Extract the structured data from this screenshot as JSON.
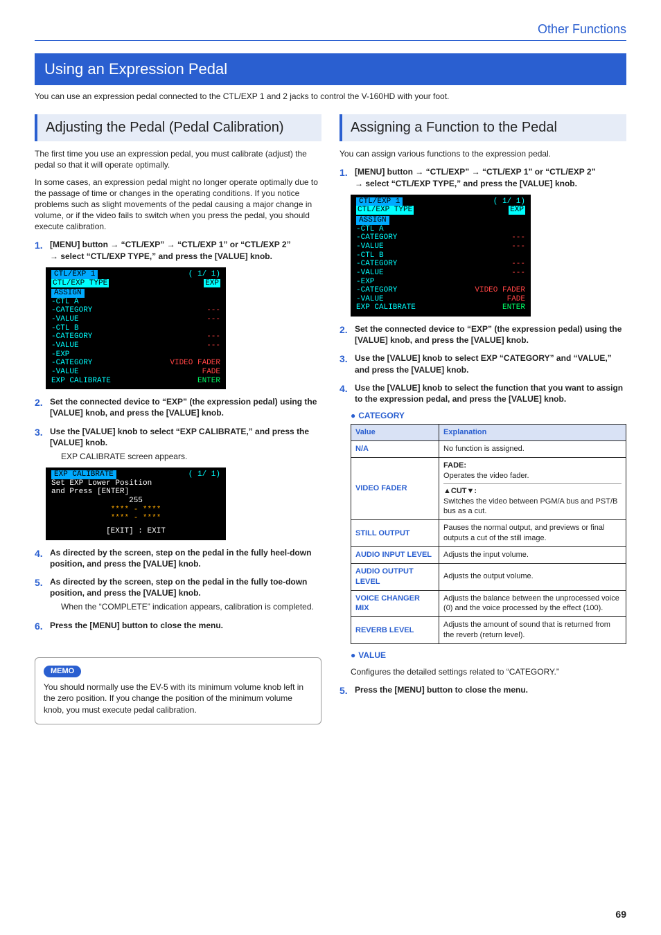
{
  "header": {
    "section": "Other Functions",
    "page_number": "69"
  },
  "h2": "Using an Expression Pedal",
  "intro": "You can use an expression pedal connected to the CTL/EXP 1 and 2 jacks to control the V-160HD with your foot.",
  "left": {
    "h3": "Adjusting the Pedal (Pedal Calibration)",
    "p1": "The first time you use an expression pedal, you must calibrate (adjust) the pedal so that it will operate optimally.",
    "p2": "In some cases, an expression pedal might no longer operate optimally due to the passage of time or changes in the operating conditions. If you notice problems such as slight movements of the pedal causing a major change in volume, or if the video fails to switch when you press the pedal, you should execute calibration.",
    "step1a": "[MENU] button → “CTL/EXP” → “CTL/EXP 1” or “CTL/EXP 2”",
    "step1b": "→ select “CTL/EXP TYPE,” and press the [VALUE] knob.",
    "screenshot1": {
      "title": "CTL/EXP 1",
      "page": "( 1/ 1)",
      "type_row": {
        "label": "CTL/EXP TYPE",
        "val": "EXP"
      },
      "assign": "ASSIGN",
      "rows": [
        {
          "l": " -CTL A",
          "v": ""
        },
        {
          "l": "  -CATEGORY",
          "v": "---"
        },
        {
          "l": "  -VALUE",
          "v": "---"
        },
        {
          "l": " -CTL B",
          "v": ""
        },
        {
          "l": "  -CATEGORY",
          "v": "---"
        },
        {
          "l": "  -VALUE",
          "v": "---"
        },
        {
          "l": " -EXP",
          "v": ""
        },
        {
          "l": "  -CATEGORY",
          "v": "VIDEO FADER",
          "red": true
        },
        {
          "l": "  -VALUE",
          "v": "FADE",
          "red": true
        },
        {
          "l": " EXP CALIBRATE",
          "v": "ENTER",
          "grn": true
        }
      ]
    },
    "step2": "Set the connected device to “EXP” (the expression pedal) using the [VALUE] knob, and press the [VALUE] knob.",
    "step3": "Use the [VALUE] knob to select “EXP CALIBRATE,” and press the [VALUE] knob.",
    "step3_after": "EXP CALIBRATE screen appears.",
    "screenshot2": {
      "title": "EXP CALIBRATE",
      "page": "( 1/ 1)",
      "line1": "Set EXP Lower Position",
      "line2": "and Press [ENTER]",
      "line3": "255",
      "bars1": "**** - ****",
      "bars2": "**** - ****",
      "exit": "[EXIT] : EXIT"
    },
    "step4": "As directed by the screen, step on the pedal in the fully heel-down position, and press the [VALUE] knob.",
    "step5": "As directed by the screen, step on the pedal in the fully toe-down position, and press the [VALUE] knob.",
    "step5_after": "When the “COMPLETE” indication appears, calibration is completed.",
    "step6": "Press the [MENU] button to close the menu.",
    "memo_tag": "MEMO",
    "memo": "You should normally use the EV-5 with its minimum volume knob left in the zero position. If you change the position of the minimum volume knob, you must execute pedal calibration."
  },
  "right": {
    "h3": "Assigning a Function to the Pedal",
    "p1": "You can assign various functions to the expression pedal.",
    "step1a": "[MENU] button → “CTL/EXP” → “CTL/EXP 1” or “CTL/EXP 2”",
    "step1b": "→ select “CTL/EXP TYPE,” and press the [VALUE] knob.",
    "step2": "Set the connected device to “EXP” (the expression pedal) using the [VALUE] knob, and press the [VALUE] knob.",
    "step3": "Use the [VALUE] knob to select EXP “CATEGORY” and “VALUE,” and press the [VALUE] knob.",
    "step4": "Use the [VALUE] knob to select the function that you want to assign to the expression pedal, and press the [VALUE] knob.",
    "cat_heading": "CATEGORY",
    "table": {
      "headers": {
        "value": "Value",
        "explanation": "Explanation"
      },
      "rows": [
        {
          "v": "N/A",
          "e": "No function is assigned."
        },
        {
          "v": "VIDEO FADER",
          "e1": "FADE:",
          "e2": "Operates the video fader.",
          "e3": "▲CUT▼:",
          "e4": "Switches the video between PGM/A bus and PST/B bus as a cut."
        },
        {
          "v": "STILL OUTPUT",
          "e": "Pauses the normal output, and previews or final outputs a cut of the still image."
        },
        {
          "v": "AUDIO INPUT LEVEL",
          "e": "Adjusts the input volume."
        },
        {
          "v": "AUDIO OUTPUT LEVEL",
          "e": "Adjusts the output volume."
        },
        {
          "v": "VOICE CHANGER MIX",
          "e": "Adjusts the balance between the unprocessed voice (0) and the voice processed by the effect (100)."
        },
        {
          "v": "REVERB LEVEL",
          "e": "Adjusts the amount of sound that is returned from the reverb (return level)."
        }
      ]
    },
    "val_heading": "VALUE",
    "val_para": "Configures the detailed settings related to “CATEGORY.”",
    "step5": "Press the [MENU] button to close the menu."
  }
}
